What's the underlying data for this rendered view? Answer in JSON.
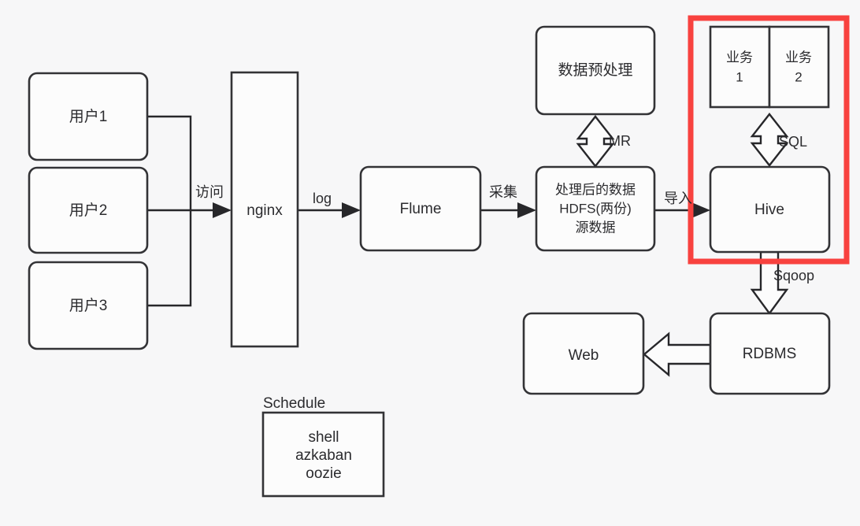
{
  "diagram": {
    "title": "Big data pipeline architecture diagram",
    "background_color": "#f7f7f8",
    "highlight_color": "#f8423f",
    "node_stroke_color": "#333336",
    "nodes": {
      "user1": "用户1",
      "user2": "用户2",
      "user3": "用户3",
      "nginx": "nginx",
      "flume": "Flume",
      "preprocess": "数据预处理",
      "hdfs_line1": "处理后的数据",
      "hdfs_line2": "HDFS(两份)",
      "hdfs_line3": "源数据",
      "business1_line1": "业务",
      "business1_line2": "1",
      "business2_line1": "业务",
      "business2_line2": "2",
      "hive": "Hive",
      "rdbms": "RDBMS",
      "web": "Web",
      "schedule_title": "Schedule",
      "schedule_line1": "shell",
      "schedule_line2": "azkaban",
      "schedule_line3": "oozie"
    },
    "edges": {
      "users_to_nginx": "访问",
      "nginx_to_flume": "log",
      "flume_to_hdfs": "采集",
      "hdfs_to_hive": "导入",
      "preprocess_hdfs": "MR",
      "business_hive": "SQL",
      "hive_to_rdbms": "Sqoop"
    }
  }
}
